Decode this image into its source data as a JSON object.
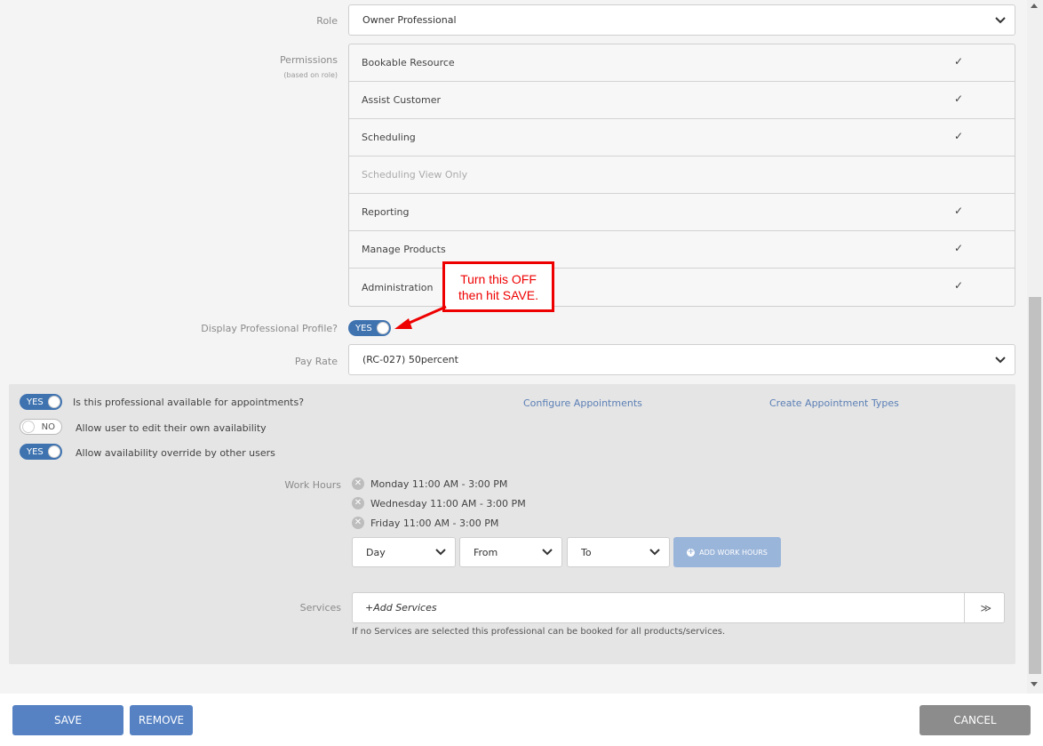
{
  "form": {
    "role_label": "Role",
    "role_value": "Owner Professional",
    "permissions_label": "Permissions",
    "permissions_sublabel": "(based on role)",
    "permissions": [
      {
        "label": "Bookable Resource",
        "checked": true,
        "disabled": false
      },
      {
        "label": "Assist Customer",
        "checked": true,
        "disabled": false
      },
      {
        "label": "Scheduling",
        "checked": true,
        "disabled": false
      },
      {
        "label": "Scheduling View Only",
        "checked": false,
        "disabled": true
      },
      {
        "label": "Reporting",
        "checked": true,
        "disabled": false
      },
      {
        "label": "Manage Products",
        "checked": true,
        "disabled": false
      },
      {
        "label": "Administration",
        "checked": true,
        "disabled": false
      }
    ],
    "display_profile_label": "Display Professional Profile?",
    "display_profile_toggle": "YES",
    "pay_rate_label": "Pay Rate",
    "pay_rate_value": "(RC-027) 50percent"
  },
  "annotation": {
    "line1": "Turn this OFF",
    "line2": "then hit SAVE.",
    "color": "#ee0000"
  },
  "availability": {
    "available_toggle": "YES",
    "available_label": "Is this professional available for appointments?",
    "edit_toggle": "NO",
    "edit_label": "Allow user to edit their own availability",
    "override_toggle": "YES",
    "override_label": "Allow availability override by other users",
    "configure_link": "Configure Appointments",
    "create_types_link": "Create Appointment Types",
    "work_hours_label": "Work Hours",
    "work_hours": [
      "Monday 11:00 AM - 3:00 PM",
      "Wednesday 11:00 AM - 3:00 PM",
      "Friday 11:00 AM - 3:00 PM"
    ],
    "day_select": "Day",
    "from_select": "From",
    "to_select": "To",
    "add_work_hours": "ADD WORK HOURS",
    "services_label": "Services",
    "services_placeholder": "+Add Services",
    "services_hint": "If no Services are selected this professional can be booked for all products/services."
  },
  "footer": {
    "save": "SAVE",
    "remove": "REMOVE",
    "cancel": "CANCEL"
  },
  "colors": {
    "primary_button": "#5682c4",
    "toggle_on": "#3f73b0",
    "link": "#5b7fb5",
    "cancel_button": "#8c8c8c"
  }
}
